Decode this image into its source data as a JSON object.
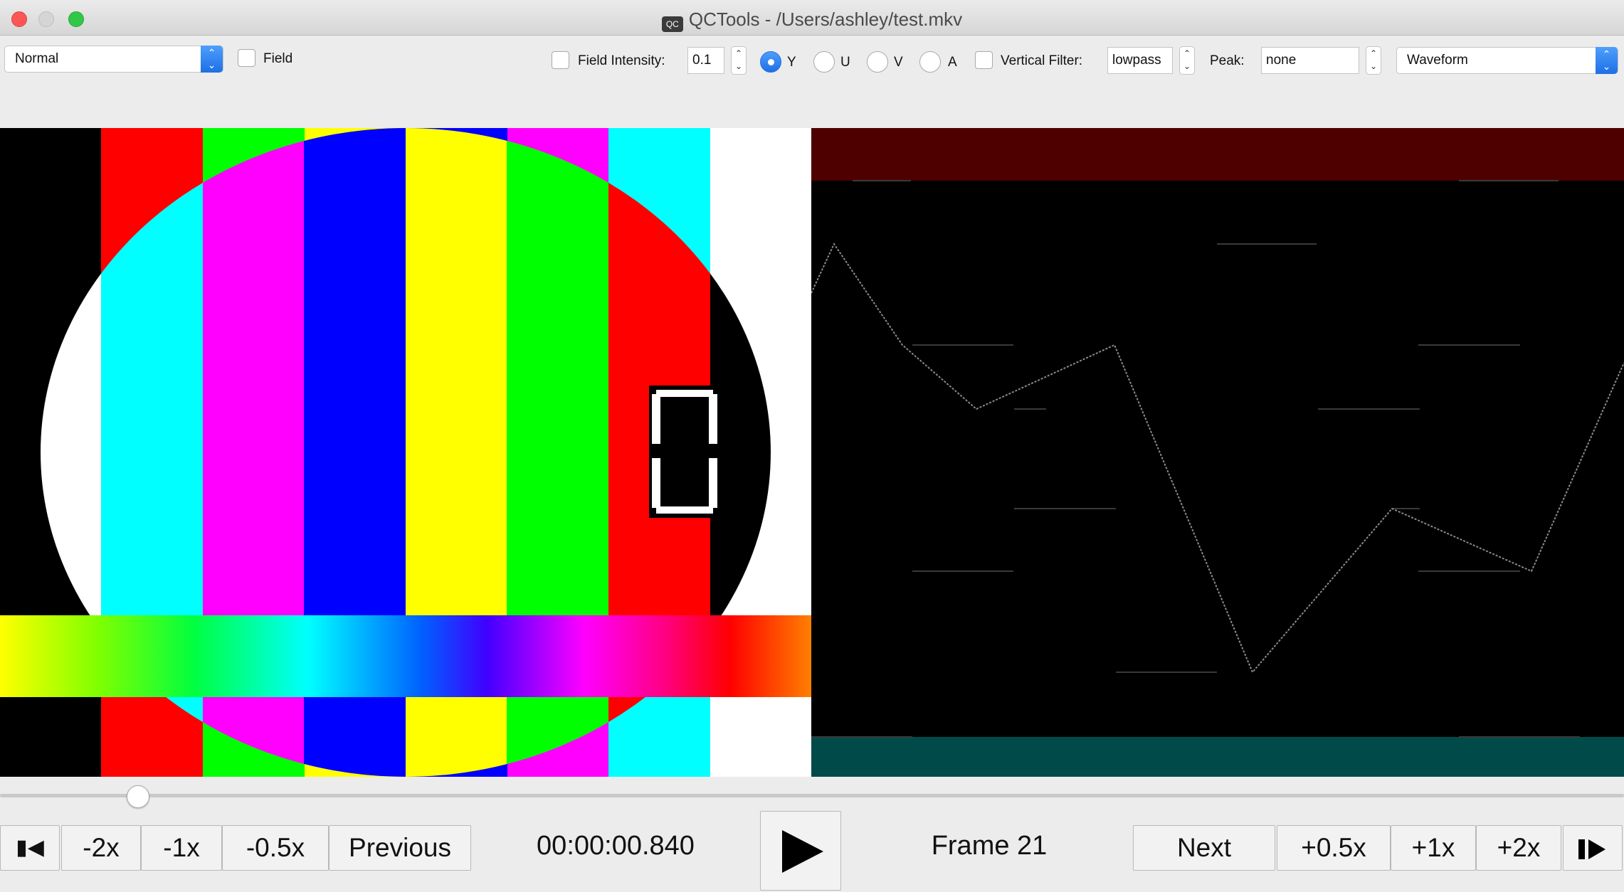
{
  "window": {
    "title": "QCTools - /Users/ashley/test.mkv",
    "app_icon_text": "QC"
  },
  "toolbar": {
    "display_mode": "Normal",
    "field_label": "Field",
    "field_intensity_label": "Field  Intensity:",
    "field_intensity_value": "0.1",
    "channels": [
      {
        "label": "Y",
        "selected": true
      },
      {
        "label": "U",
        "selected": false
      },
      {
        "label": "V",
        "selected": false
      },
      {
        "label": "A",
        "selected": false
      }
    ],
    "vertical_filter_label": "Vertical  Filter:",
    "vertical_filter_value": "lowpass",
    "peak_label": "Peak:",
    "peak_value": "none",
    "filter_select": "Waveform"
  },
  "player": {
    "seek_position": 0.085,
    "counter_digit": "0"
  },
  "controls": {
    "step_back": "▮◀",
    "minus_2x": "-2x",
    "minus_1x": "-1x",
    "minus_half": "-0.5x",
    "previous": "Previous",
    "timecode": "00:00:00.840",
    "frame": "Frame 21",
    "next": "Next",
    "plus_half": "+0.5x",
    "plus_1x": "+1x",
    "plus_2x": "+2x"
  },
  "colors": {
    "radio_accent": "#1d6fe6",
    "waveform_top_band": "#4e0000",
    "waveform_bottom_band": "#004a4a"
  },
  "icons": {
    "step_back": "step-back-icon",
    "play": "play-icon",
    "step_forward": "step-forward-icon"
  }
}
